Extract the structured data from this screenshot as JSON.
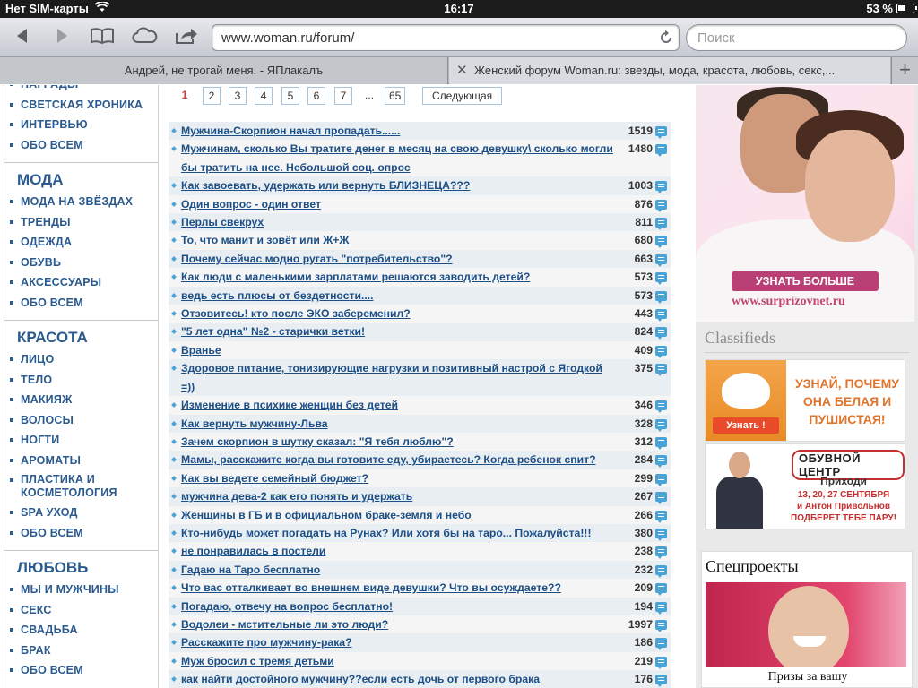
{
  "status_bar": {
    "carrier": "Нет SIM-карты",
    "time": "16:17",
    "battery_pct": "53 %",
    "battery_level": 0.53
  },
  "toolbar": {
    "url": "www.woman.ru/forum/",
    "search_placeholder": "Поиск",
    "icons": [
      "back-arrow-icon",
      "forward-arrow-icon",
      "bookmarks-icon",
      "icloud-icon",
      "share-icon",
      "reload-icon"
    ]
  },
  "tabs": [
    {
      "title": "Андрей, не трогай меня. - ЯПлакалъ"
    },
    {
      "title": "Женский форум Woman.ru: звезды, мода, красота, любовь, секс,..."
    }
  ],
  "sidebar": {
    "top_links": [
      "НАГРАДЫ",
      "СВЕТСКАЯ ХРОНИКА",
      "ИНТЕРВЬЮ",
      "ОБО ВСЕМ"
    ],
    "sections": [
      {
        "heading": "МОДА",
        "links": [
          "МОДА НА ЗВЁЗДАХ",
          "ТРЕНДЫ",
          "ОДЕЖДА",
          "ОБУВЬ",
          "АКСЕССУАРЫ",
          "ОБО ВСЕМ"
        ]
      },
      {
        "heading": "КРАСОТА",
        "links": [
          "ЛИЦО",
          "ТЕЛО",
          "МАКИЯЖ",
          "ВОЛОСЫ",
          "НОГТИ",
          "АРОМАТЫ",
          "ПЛАСТИКА И КОСМЕТОЛОГИЯ",
          "SPA УХОД",
          "ОБО ВСЕМ"
        ]
      },
      {
        "heading": "ЛЮБОВЬ",
        "links": [
          "МЫ И МУЖЧИНЫ",
          "СЕКС",
          "СВАДЬБА",
          "БРАК",
          "ОБО ВСЕМ"
        ]
      }
    ]
  },
  "pager": {
    "current": "1",
    "pages": [
      "2",
      "3",
      "4",
      "5",
      "6",
      "7"
    ],
    "ellipsis": "...",
    "last": "65",
    "next_label": "Следующая"
  },
  "topics": [
    {
      "title": "Мужчина-Скорпион начал пропадать......",
      "count": "1519"
    },
    {
      "title": "Мужчинам, сколько Вы тратите денег в месяц на свою девушку\\ сколько могли бы тратить на нее. Небольшой соц. опрос",
      "count": "1480"
    },
    {
      "title": "Как завоевать, удержать или вернуть БЛИЗНЕЦА???",
      "count": "1003"
    },
    {
      "title": "Один вопрос - один ответ",
      "count": "876"
    },
    {
      "title": "Перлы свекрух",
      "count": "811"
    },
    {
      "title": "То, что манит и зовёт или Ж+Ж",
      "count": "680"
    },
    {
      "title": "Почему сейчас модно ругать \"потребительство\"?",
      "count": "663"
    },
    {
      "title": "Как люди с маленькими зарплатами решаются заводить детей?",
      "count": "573"
    },
    {
      "title": "ведь есть плюсы от бездетности....",
      "count": "573"
    },
    {
      "title": "Отзовитесь! кто после ЭКО забеременил?",
      "count": "443"
    },
    {
      "title": "\"5 лет одна\" №2 - старички ветки!",
      "count": "824"
    },
    {
      "title": "Вранье",
      "count": "409"
    },
    {
      "title": "Здоровое питание, тонизирующие нагрузки и позитивный настрой с Ягодкой =))",
      "count": "375"
    },
    {
      "title": "Изменение в психике женщин без детей",
      "count": "346"
    },
    {
      "title": "Как вернуть мужчину-Льва",
      "count": "328"
    },
    {
      "title": "Зачем скорпион в шутку сказал: \"Я тебя люблю\"?",
      "count": "312"
    },
    {
      "title": "Мамы, расскажите когда вы готовите еду, убираетесь? Когда ребенок спит?",
      "count": "284"
    },
    {
      "title": "Как вы ведете семейный бюджет?",
      "count": "299"
    },
    {
      "title": "мужчина дева-2 как его понять и удержать",
      "count": "267"
    },
    {
      "title": "Женщины в ГБ и в официальном браке-земля и небо",
      "count": "266"
    },
    {
      "title": "Кто-нибудь может погадать на Рунах? Или хотя бы на таро... Пожалуйста!!!",
      "count": "380"
    },
    {
      "title": "не понравилась в постели",
      "count": "238"
    },
    {
      "title": "Гадаю на Таро бесплатно",
      "count": "232"
    },
    {
      "title": "Что вас отталкивает во внешнем виде девушки? Что вы осуждаете??",
      "count": "209"
    },
    {
      "title": "Погадаю, отвечу на вопрос бесплатно!",
      "count": "194"
    },
    {
      "title": "Водолеи - мстительные ли это люди?",
      "count": "1997"
    },
    {
      "title": "Расскажите про мужчину-рака?",
      "count": "186"
    },
    {
      "title": "Муж бросил с тремя детьми",
      "count": "219"
    },
    {
      "title": "как найти достойного мужчину??если есть дочь от первого брака",
      "count": "176"
    },
    {
      "title": "хотим снизить алименты, часть 2",
      "count": "164"
    }
  ],
  "right": {
    "ad_main": {
      "cta": "УЗНАТЬ БОЛЬШЕ",
      "site": "www.surprizovnet.ru"
    },
    "classifieds_title": "Classifieds",
    "ad_frog": {
      "button": "Узнать !",
      "text": "УЗНАЙ, ПОЧЕМУ ОНА БЕЛАЯ И ПУШИСТАЯ!"
    },
    "ad_club": {
      "logo": "ОБУВНОЙ ЦЕНТР",
      "line1": "Приходи",
      "line2": "13, 20, 27 СЕНТЯБРЯ",
      "line3": "и Антон Привольнов",
      "line4": "ПОДБЕРЕТ ТЕБЕ ПАРУ!"
    },
    "special_title": "Спецпроекты",
    "special_caption": "Призы за вашу"
  },
  "colors": {
    "link": "#1c4f85",
    "nav": "#2b5a8e",
    "accent": "#4aa3d6",
    "current_page": "#d63b3b"
  }
}
